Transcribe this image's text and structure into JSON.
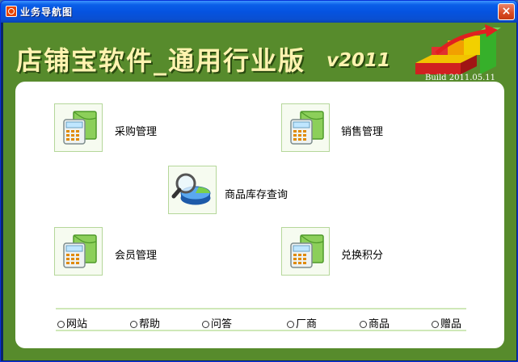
{
  "window": {
    "title": "业务导航图",
    "close_label": "×"
  },
  "logo": {
    "title": "店铺宝软件_通用行业版",
    "version": "v2011",
    "build": "Build 2011.05.11"
  },
  "tiles": {
    "purchase": "采购管理",
    "sales": "销售管理",
    "inventory": "商品库存查询",
    "member": "会员管理",
    "points": "兑换积分"
  },
  "links": [
    "网站",
    "帮助",
    "问答",
    "厂商",
    "商品",
    "赠品"
  ],
  "colors": {
    "background_green": "#578b2c",
    "titlebar_blue": "#0553e0",
    "logo_text": "#fff3b0",
    "panel": "#ffffff"
  }
}
